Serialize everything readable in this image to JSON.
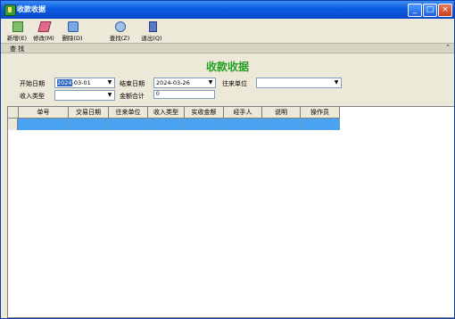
{
  "window": {
    "title": "收款收据"
  },
  "toolbar": {
    "add": "新增(E)",
    "edit": "修改(M)",
    "delete": "删除(D)",
    "find": "查找(Z)",
    "exit": "退出(Q)"
  },
  "query_bar": {
    "label": "查 找",
    "collapse_icon": "chevrons-up-icon"
  },
  "form": {
    "heading": "收款收据",
    "start_date_label": "开始日期",
    "start_date_highlight": "2024",
    "start_date_rest": "-03-01",
    "end_date_label": "结束日期",
    "end_date_value": "2024-03-26",
    "partner_label": "往来单位",
    "partner_value": "",
    "income_type_label": "收入类型",
    "income_type_value": "",
    "amount_label": "金额合计",
    "amount_value": "0"
  },
  "table": {
    "columns": [
      "单号",
      "交易日期",
      "往来单位",
      "收入类型",
      "实收金额",
      "经手人",
      "说明",
      "操作员"
    ],
    "rows": [
      [
        "",
        "",
        "",
        "",
        "",
        "",
        "",
        ""
      ]
    ]
  },
  "colors": {
    "title_bar": "#0a5ae0",
    "heading": "#22a022",
    "selection": "#4aa3f0"
  }
}
